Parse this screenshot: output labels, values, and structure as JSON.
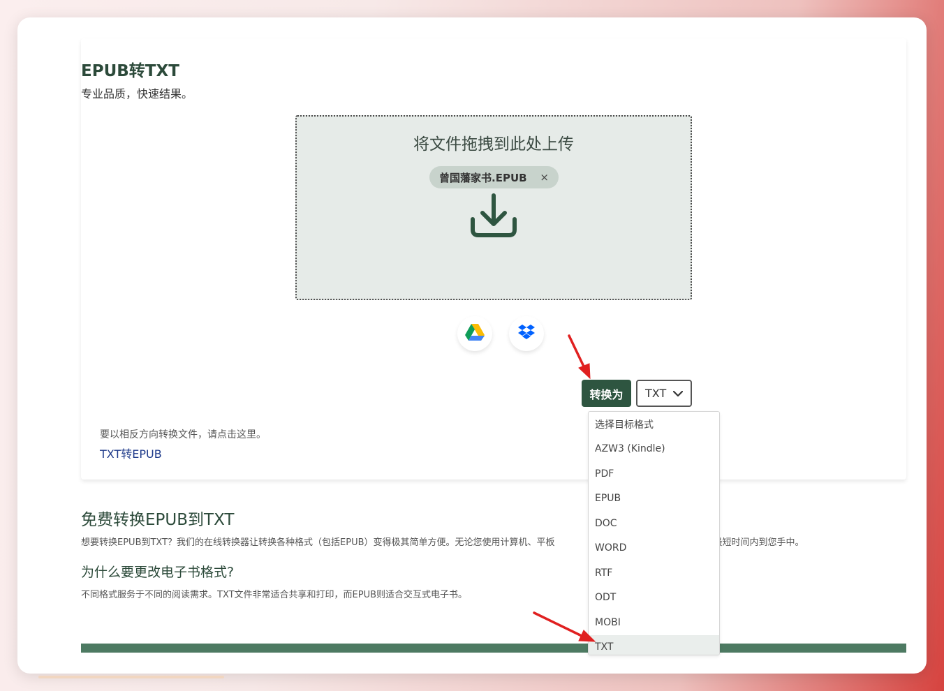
{
  "page": {
    "title": "EPUB转TXT",
    "subtitle": "专业品质，快速结果。"
  },
  "dropzone": {
    "prompt": "将文件拖拽到此处上传",
    "file_name": "曾国藩家书.EPUB",
    "remove_icon": "×"
  },
  "cloud_sources": {
    "google_drive_icon": "google-drive-icon",
    "dropbox_icon": "dropbox-icon"
  },
  "convert": {
    "button_label": "转换为",
    "selected_format": "TXT"
  },
  "format_options": [
    "选择目标格式",
    "AZW3 (Kindle)",
    "PDF",
    "EPUB",
    "DOC",
    "WORD",
    "RTF",
    "ODT",
    "MOBI",
    "TXT"
  ],
  "reverse": {
    "note": "要以相反方向转换文件，请点击这里。",
    "link": "TXT转EPUB"
  },
  "section1": {
    "title": "免费转换EPUB到TXT",
    "text_left": "想要转换EPUB到TXT？我们的在线转换器让转换各种格式（包括EPUB）变得极其简单方便。无论您使用计算机、平板",
    "text_right": "件将在最短时间内到您手中。"
  },
  "section2": {
    "title": "为什么要更改电子书格式?",
    "text": "不同格式服务于不同的阅读需求。TXT文件非常适合共享和打印，而EPUB则适合交互式电子书。"
  },
  "colors": {
    "primary_green": "#2e5540",
    "dropzone_bg": "#e6ebe8",
    "link_blue": "#1e3a8a",
    "annotation_red": "#e02020"
  }
}
